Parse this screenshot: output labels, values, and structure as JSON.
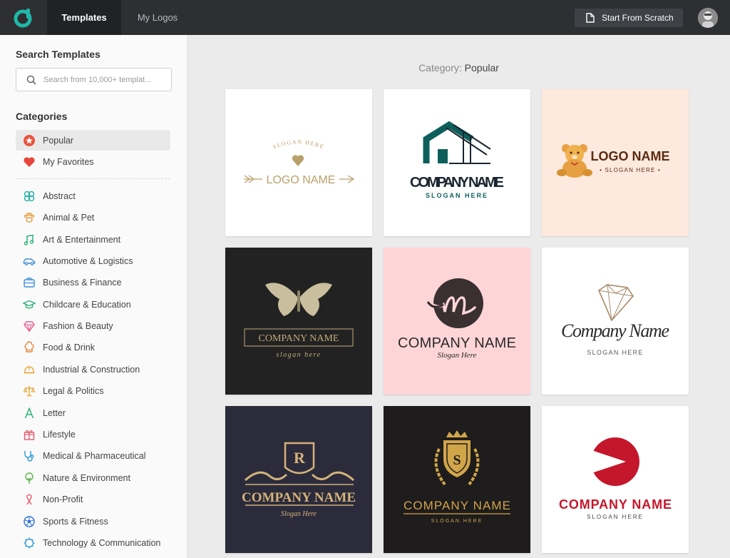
{
  "header": {
    "tabs": [
      {
        "label": "Templates",
        "active": true
      },
      {
        "label": "My Logos",
        "active": false
      }
    ],
    "scratch_button": "Start From Scratch",
    "brand_color": "#1fb8a8"
  },
  "sidebar": {
    "search_title": "Search Templates",
    "search_placeholder": "Search from 10,000+ templat...",
    "categories_title": "Categories",
    "pinned": [
      {
        "label": "Popular",
        "icon": "star-badge-icon",
        "active": true
      },
      {
        "label": "My Favorites",
        "icon": "heart-icon",
        "active": false
      }
    ],
    "items": [
      {
        "label": "Abstract",
        "icon": "abstract-icon"
      },
      {
        "label": "Animal & Pet",
        "icon": "paw-icon"
      },
      {
        "label": "Art & Entertainment",
        "icon": "music-note-icon"
      },
      {
        "label": "Automotive & Logistics",
        "icon": "car-icon"
      },
      {
        "label": "Business & Finance",
        "icon": "briefcase-icon"
      },
      {
        "label": "Childcare & Education",
        "icon": "graduation-cap-icon"
      },
      {
        "label": "Fashion & Beauty",
        "icon": "diamond-icon"
      },
      {
        "label": "Food & Drink",
        "icon": "chef-hat-icon"
      },
      {
        "label": "Industrial & Construction",
        "icon": "hard-hat-icon"
      },
      {
        "label": "Legal & Politics",
        "icon": "scales-icon"
      },
      {
        "label": "Letter",
        "icon": "letter-a-icon"
      },
      {
        "label": "Lifestyle",
        "icon": "gift-icon"
      },
      {
        "label": "Medical & Pharmaceutical",
        "icon": "stethoscope-icon"
      },
      {
        "label": "Nature & Environment",
        "icon": "tree-icon"
      },
      {
        "label": "Non-Profit",
        "icon": "ribbon-icon"
      },
      {
        "label": "Sports & Fitness",
        "icon": "soccer-ball-icon"
      },
      {
        "label": "Technology & Communication",
        "icon": "chip-icon"
      }
    ]
  },
  "main": {
    "category_prefix": "Category:",
    "category_name": "Popular",
    "templates": [
      {
        "name": "LOGO NAME",
        "slogan": "SLOGAN HERE",
        "bg": "#ffffff"
      },
      {
        "name": "COMPANY NAME",
        "slogan": "SLOGAN HERE",
        "bg": "#ffffff"
      },
      {
        "name": "LOGO NAME",
        "slogan": "• SLOGAN HERE •",
        "bg": "#fde9dd"
      },
      {
        "name": "COMPANY NAME",
        "slogan": "slogan here",
        "bg": "#222222"
      },
      {
        "name": "COMPANY NAME",
        "slogan": "Slogan Here",
        "bg": "#fdd5d7"
      },
      {
        "name": "Company Name",
        "slogan": "SLOGAN HERE",
        "bg": "#ffffff"
      },
      {
        "name": "COMPANY NAME",
        "slogan": "Slogan Here",
        "initial": "R",
        "bg": "#2b2b3b"
      },
      {
        "name": "COMPANY NAME",
        "slogan": "SLOGAN HERE",
        "initial": "S",
        "bg": "#1e1c1c"
      },
      {
        "name": "COMPANY NAME",
        "slogan": "SLOGAN HERE",
        "bg": "#ffffff"
      }
    ]
  }
}
